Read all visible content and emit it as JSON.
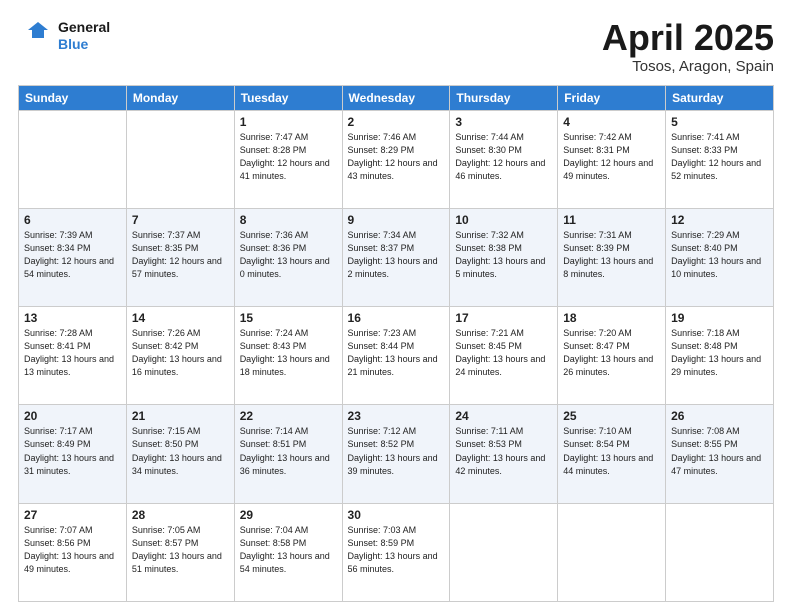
{
  "header": {
    "logo_line1": "General",
    "logo_line2": "Blue",
    "main_title": "April 2025",
    "subtitle": "Tosos, Aragon, Spain"
  },
  "weekdays": [
    "Sunday",
    "Monday",
    "Tuesday",
    "Wednesday",
    "Thursday",
    "Friday",
    "Saturday"
  ],
  "rows": [
    [
      {
        "day": "",
        "info": ""
      },
      {
        "day": "",
        "info": ""
      },
      {
        "day": "1",
        "info": "Sunrise: 7:47 AM\nSunset: 8:28 PM\nDaylight: 12 hours and 41 minutes."
      },
      {
        "day": "2",
        "info": "Sunrise: 7:46 AM\nSunset: 8:29 PM\nDaylight: 12 hours and 43 minutes."
      },
      {
        "day": "3",
        "info": "Sunrise: 7:44 AM\nSunset: 8:30 PM\nDaylight: 12 hours and 46 minutes."
      },
      {
        "day": "4",
        "info": "Sunrise: 7:42 AM\nSunset: 8:31 PM\nDaylight: 12 hours and 49 minutes."
      },
      {
        "day": "5",
        "info": "Sunrise: 7:41 AM\nSunset: 8:33 PM\nDaylight: 12 hours and 52 minutes."
      }
    ],
    [
      {
        "day": "6",
        "info": "Sunrise: 7:39 AM\nSunset: 8:34 PM\nDaylight: 12 hours and 54 minutes."
      },
      {
        "day": "7",
        "info": "Sunrise: 7:37 AM\nSunset: 8:35 PM\nDaylight: 12 hours and 57 minutes."
      },
      {
        "day": "8",
        "info": "Sunrise: 7:36 AM\nSunset: 8:36 PM\nDaylight: 13 hours and 0 minutes."
      },
      {
        "day": "9",
        "info": "Sunrise: 7:34 AM\nSunset: 8:37 PM\nDaylight: 13 hours and 2 minutes."
      },
      {
        "day": "10",
        "info": "Sunrise: 7:32 AM\nSunset: 8:38 PM\nDaylight: 13 hours and 5 minutes."
      },
      {
        "day": "11",
        "info": "Sunrise: 7:31 AM\nSunset: 8:39 PM\nDaylight: 13 hours and 8 minutes."
      },
      {
        "day": "12",
        "info": "Sunrise: 7:29 AM\nSunset: 8:40 PM\nDaylight: 13 hours and 10 minutes."
      }
    ],
    [
      {
        "day": "13",
        "info": "Sunrise: 7:28 AM\nSunset: 8:41 PM\nDaylight: 13 hours and 13 minutes."
      },
      {
        "day": "14",
        "info": "Sunrise: 7:26 AM\nSunset: 8:42 PM\nDaylight: 13 hours and 16 minutes."
      },
      {
        "day": "15",
        "info": "Sunrise: 7:24 AM\nSunset: 8:43 PM\nDaylight: 13 hours and 18 minutes."
      },
      {
        "day": "16",
        "info": "Sunrise: 7:23 AM\nSunset: 8:44 PM\nDaylight: 13 hours and 21 minutes."
      },
      {
        "day": "17",
        "info": "Sunrise: 7:21 AM\nSunset: 8:45 PM\nDaylight: 13 hours and 24 minutes."
      },
      {
        "day": "18",
        "info": "Sunrise: 7:20 AM\nSunset: 8:47 PM\nDaylight: 13 hours and 26 minutes."
      },
      {
        "day": "19",
        "info": "Sunrise: 7:18 AM\nSunset: 8:48 PM\nDaylight: 13 hours and 29 minutes."
      }
    ],
    [
      {
        "day": "20",
        "info": "Sunrise: 7:17 AM\nSunset: 8:49 PM\nDaylight: 13 hours and 31 minutes."
      },
      {
        "day": "21",
        "info": "Sunrise: 7:15 AM\nSunset: 8:50 PM\nDaylight: 13 hours and 34 minutes."
      },
      {
        "day": "22",
        "info": "Sunrise: 7:14 AM\nSunset: 8:51 PM\nDaylight: 13 hours and 36 minutes."
      },
      {
        "day": "23",
        "info": "Sunrise: 7:12 AM\nSunset: 8:52 PM\nDaylight: 13 hours and 39 minutes."
      },
      {
        "day": "24",
        "info": "Sunrise: 7:11 AM\nSunset: 8:53 PM\nDaylight: 13 hours and 42 minutes."
      },
      {
        "day": "25",
        "info": "Sunrise: 7:10 AM\nSunset: 8:54 PM\nDaylight: 13 hours and 44 minutes."
      },
      {
        "day": "26",
        "info": "Sunrise: 7:08 AM\nSunset: 8:55 PM\nDaylight: 13 hours and 47 minutes."
      }
    ],
    [
      {
        "day": "27",
        "info": "Sunrise: 7:07 AM\nSunset: 8:56 PM\nDaylight: 13 hours and 49 minutes."
      },
      {
        "day": "28",
        "info": "Sunrise: 7:05 AM\nSunset: 8:57 PM\nDaylight: 13 hours and 51 minutes."
      },
      {
        "day": "29",
        "info": "Sunrise: 7:04 AM\nSunset: 8:58 PM\nDaylight: 13 hours and 54 minutes."
      },
      {
        "day": "30",
        "info": "Sunrise: 7:03 AM\nSunset: 8:59 PM\nDaylight: 13 hours and 56 minutes."
      },
      {
        "day": "",
        "info": ""
      },
      {
        "day": "",
        "info": ""
      },
      {
        "day": "",
        "info": ""
      }
    ]
  ]
}
